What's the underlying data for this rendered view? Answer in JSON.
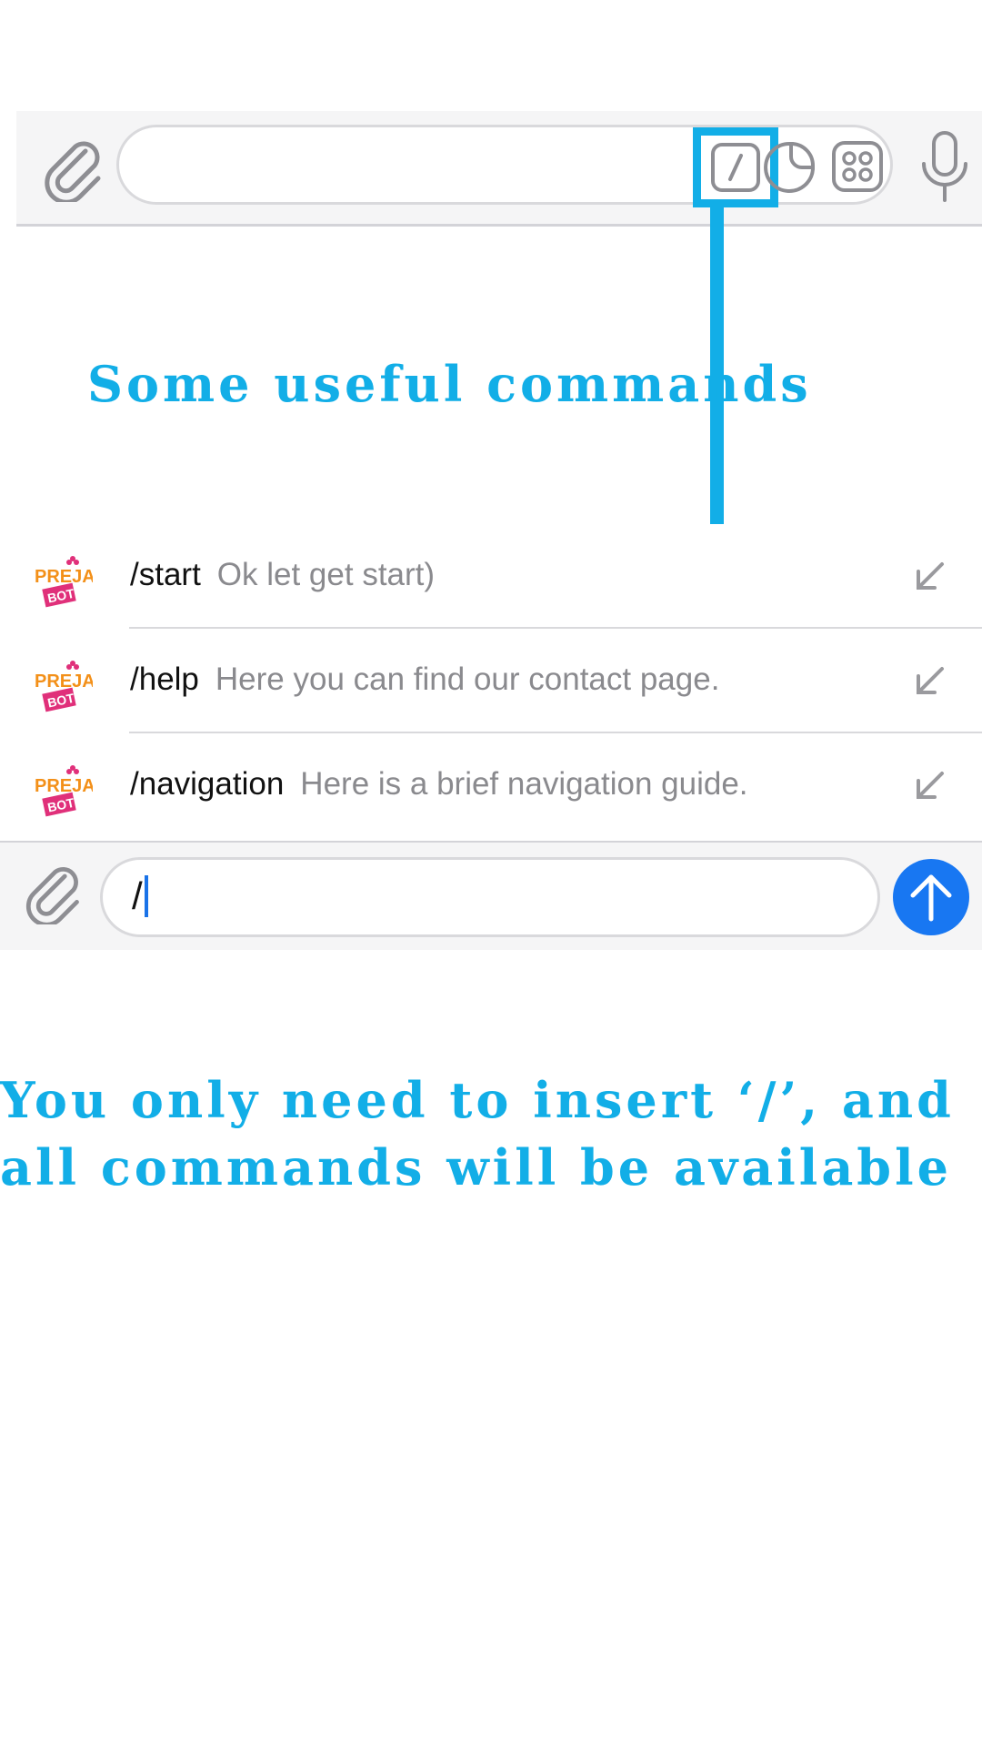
{
  "top_bar": {
    "attach_icon": "paperclip-icon",
    "commands_icon": "slash-command-icon",
    "sticker_icon": "sticker-icon",
    "apps_icon": "apps-grid-icon",
    "mic_icon": "microphone-icon"
  },
  "heading": "Some useful commands",
  "commands": [
    {
      "avatar_text": [
        "PREJA",
        "BOT"
      ],
      "name": "/start",
      "description": "Ok let get start)"
    },
    {
      "avatar_text": [
        "PREJA",
        "BOT"
      ],
      "name": "/help",
      "description": "Here you can find our contact page."
    },
    {
      "avatar_text": [
        "PREJA",
        "BOT"
      ],
      "name": "/navigation",
      "description": "Here is a brief navigation guide."
    }
  ],
  "bottom_bar": {
    "input_value": "/",
    "attach_icon": "paperclip-icon",
    "send_icon": "send-arrow-icon"
  },
  "caption": {
    "line1": "You only need to insert ‘/’, and",
    "line2": "all commands will be available"
  },
  "colors": {
    "accent": "#12aee7",
    "send_button": "#1877f2",
    "bar_background": "#f5f5f6",
    "secondary_text": "#8a8a8e"
  }
}
